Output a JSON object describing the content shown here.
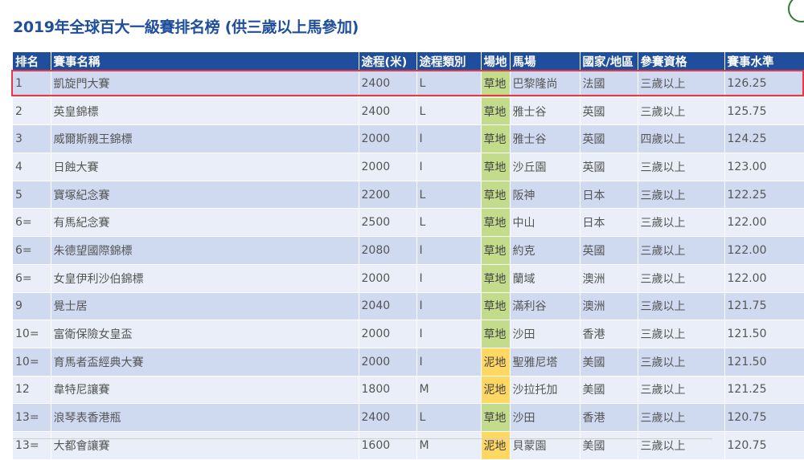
{
  "page": {
    "title": "2019年全球百大一級賽排名榜 (供三歲以上馬參加)"
  },
  "table": {
    "headers": [
      "排名",
      "賽事名稱",
      "途程(米)",
      "途程類別",
      "場地",
      "馬場",
      "國家/地區",
      "參賽資格",
      "賽事水準"
    ],
    "rows": [
      [
        "1",
        "凱旋門大賽",
        "2400",
        "L",
        "草地",
        "巴黎隆尚",
        "法國",
        "三歲以上",
        "126.25"
      ],
      [
        "2",
        "英皇錦標",
        "2400",
        "L",
        "草地",
        "雅士谷",
        "英國",
        "三歲以上",
        "125.75"
      ],
      [
        "3",
        "威爾斯親王錦標",
        "2000",
        "I",
        "草地",
        "雅士谷",
        "英國",
        "四歲以上",
        "124.25"
      ],
      [
        "4",
        "日蝕大賽",
        "2000",
        "I",
        "草地",
        "沙丘園",
        "英國",
        "三歲以上",
        "123.00"
      ],
      [
        "5",
        "寶塚紀念賽",
        "2200",
        "L",
        "草地",
        "阪神",
        "日本",
        "三歲以上",
        "122.25"
      ],
      [
        "6=",
        "有馬紀念賽",
        "2500",
        "L",
        "草地",
        "中山",
        "日本",
        "三歲以上",
        "122.00"
      ],
      [
        "6=",
        "朱德望國際錦標",
        "2080",
        "I",
        "草地",
        "約克",
        "英國",
        "三歲以上",
        "122.00"
      ],
      [
        "6=",
        "女皇伊利沙伯錦標",
        "2000",
        "I",
        "草地",
        "蘭域",
        "澳洲",
        "三歲以上",
        "122.00"
      ],
      [
        "9",
        "覺士居",
        "2040",
        "I",
        "草地",
        "滿利谷",
        "澳洲",
        "三歲以上",
        "121.75"
      ],
      [
        "10=",
        "富衛保險女皇盃",
        "2000",
        "I",
        "草地",
        "沙田",
        "香港",
        "三歲以上",
        "121.50"
      ],
      [
        "10=",
        "育馬者盃經典大賽",
        "2000",
        "I",
        "泥地",
        "聖雅尼塔",
        "美國",
        "三歲以上",
        "121.50"
      ],
      [
        "12",
        "韋特尼讓賽",
        "1800",
        "M",
        "泥地",
        "沙拉托加",
        "美國",
        "三歲以上",
        "121.25"
      ],
      [
        "13=",
        "浪琴表香港瓶",
        "2400",
        "L",
        "草地",
        "沙田",
        "香港",
        "三歲以上",
        "120.75"
      ],
      [
        "13=",
        "大都會讓賽",
        "1600",
        "M",
        "泥地",
        "貝蒙園",
        "美國",
        "三歲以上",
        "120.75"
      ]
    ],
    "surface_colors": {
      "草地": "#c2dc8c",
      "泥地": "#ffd763"
    },
    "header_color": "#1f4e9c",
    "highlighted_row": 0
  }
}
